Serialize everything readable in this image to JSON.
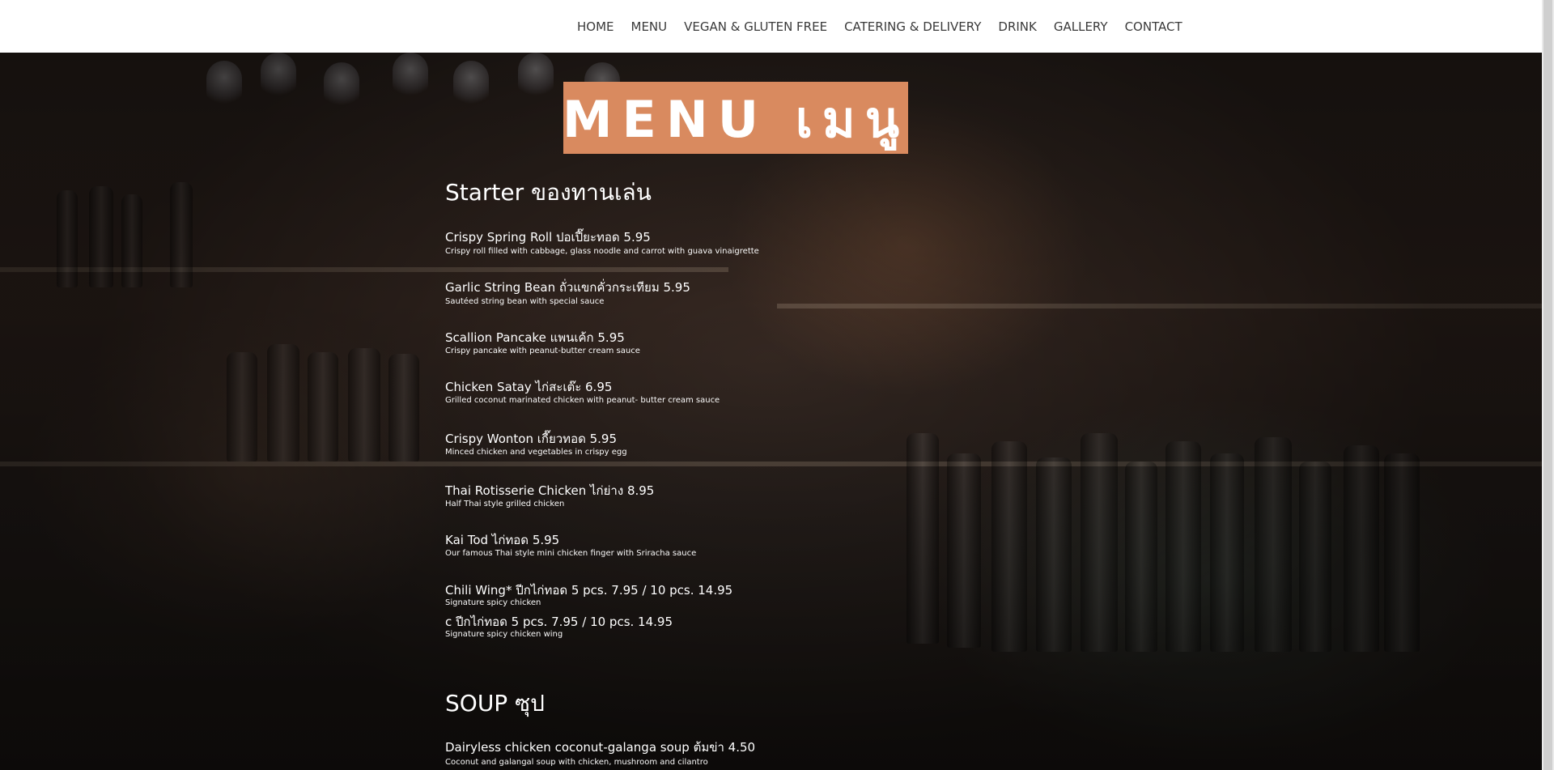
{
  "nav": {
    "items": [
      {
        "label": "HOME"
      },
      {
        "label": "MENU"
      },
      {
        "label": "VEGAN & GLUTEN FREE"
      },
      {
        "label": "CATERING & DELIVERY"
      },
      {
        "label": "DRINK"
      },
      {
        "label": "GALLERY"
      },
      {
        "label": "CONTACT"
      }
    ]
  },
  "banner": {
    "text": "MENU เมนู",
    "background_color": "#d98a5f"
  },
  "sections": {
    "starter": {
      "title": "Starter ของทานเล่น",
      "items": [
        {
          "title": "Crispy Spring Roll ปอเปี๊ยะทอด   5.95",
          "desc": "Crispy roll filled with cabbage, glass noodle and carrot with guava vinaigrette"
        },
        {
          "title": "Garlic String Bean ถั่วแขกคั่วกระเทียม   5.95",
          "desc": "Sautéed  string bean with special sauce"
        },
        {
          "title": "Scallion Pancake แพนเค้ก   5.95",
          "desc": "Crispy pancake with peanut-butter cream sauce"
        },
        {
          "title": "Chicken Satay ไก่สะเต๊ะ   6.95",
          "desc": "Grilled coconut marinated chicken with peanut- butter cream sauce"
        },
        {
          "title": "Crispy Wonton เกี๊ยวทอด   5.95",
          "desc": "Minced chicken and vegetables in crispy egg"
        },
        {
          "title": "Thai Rotisserie Chicken ไก่ย่าง   8.95",
          "desc": "Half Thai style grilled chicken"
        },
        {
          "title": "Kai Tod ไก่ทอด   5.95",
          "desc": "Our famous Thai style mini chicken finger with Sriracha sauce"
        },
        {
          "title": "Chili Wing* ปีกไก่ทอด   5 pcs. 7.95 / 10 pcs. 14.95",
          "desc": "Signature spicy chicken"
        },
        {
          "title": "c ปีกไก่ทอด   5 pcs. 7.95 / 10 pcs. 14.95",
          "desc": "Signature spicy chicken wing"
        }
      ]
    },
    "soup": {
      "title": "SOUP ซุป",
      "items": [
        {
          "title": "Dairyless chicken coconut-galanga soup ต้มข่า 4.50",
          "desc": "Coconut and galangal soup with chicken, mushroom and cilantro"
        }
      ]
    }
  }
}
